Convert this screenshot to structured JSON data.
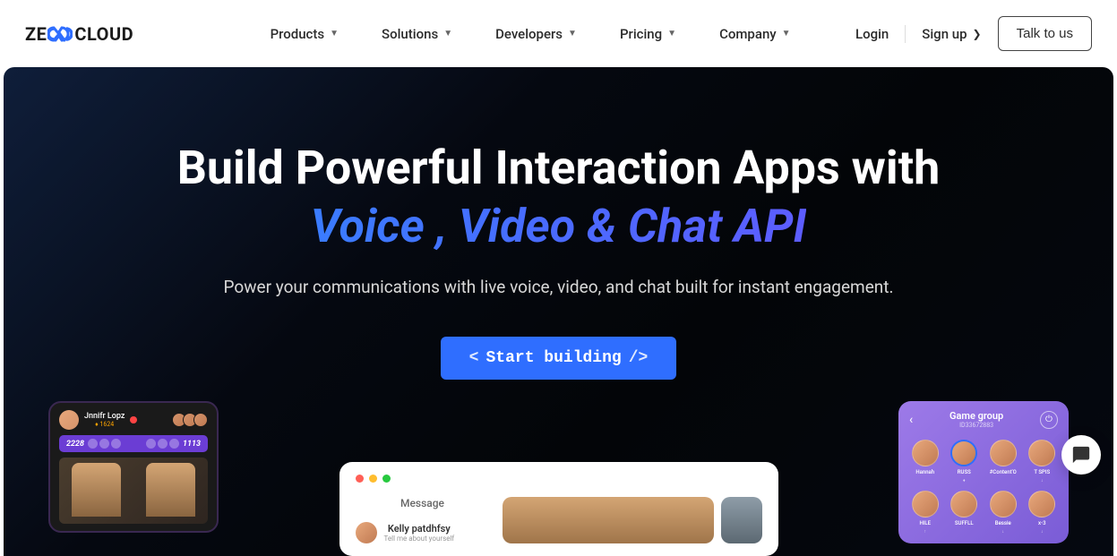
{
  "logo": {
    "prefix": "ZE",
    "suffix": "CLOUD"
  },
  "nav": {
    "items": [
      {
        "label": "Products"
      },
      {
        "label": "Solutions"
      },
      {
        "label": "Developers"
      },
      {
        "label": "Pricing"
      },
      {
        "label": "Company"
      }
    ]
  },
  "actions": {
    "login": "Login",
    "signup": "Sign up",
    "talk": "Talk to us"
  },
  "hero": {
    "title_line1": "Build Powerful Interaction Apps with",
    "title_line2": "Voice , Video & Chat API",
    "subtitle": "Power your communications with live voice, video, and chat built for instant engagement.",
    "cta": "Start building"
  },
  "mockup_left": {
    "user_name": "Jnnifr Lopz",
    "user_sub": "♦ 1624",
    "count_left": "2228",
    "count_right": "1113"
  },
  "mockup_center": {
    "message_label": "Message",
    "contact_name": "Kelly patdhfsy",
    "contact_sub": "Tell me about yourself"
  },
  "mockup_right": {
    "title": "Game group",
    "id": "ID33672883",
    "users": [
      {
        "name": "Hannah",
        "tag": ""
      },
      {
        "name": "RUSS",
        "tag": "♦"
      },
      {
        "name": "#Content'O",
        "tag": ""
      },
      {
        "name": "T SPIS",
        "tag": "↓"
      },
      {
        "name": "HILE",
        "tag": "↑"
      },
      {
        "name": "SUFFLL",
        "tag": ""
      },
      {
        "name": "Bessie",
        "tag": "↓"
      },
      {
        "name": "x-3",
        "tag": "↓"
      }
    ]
  }
}
